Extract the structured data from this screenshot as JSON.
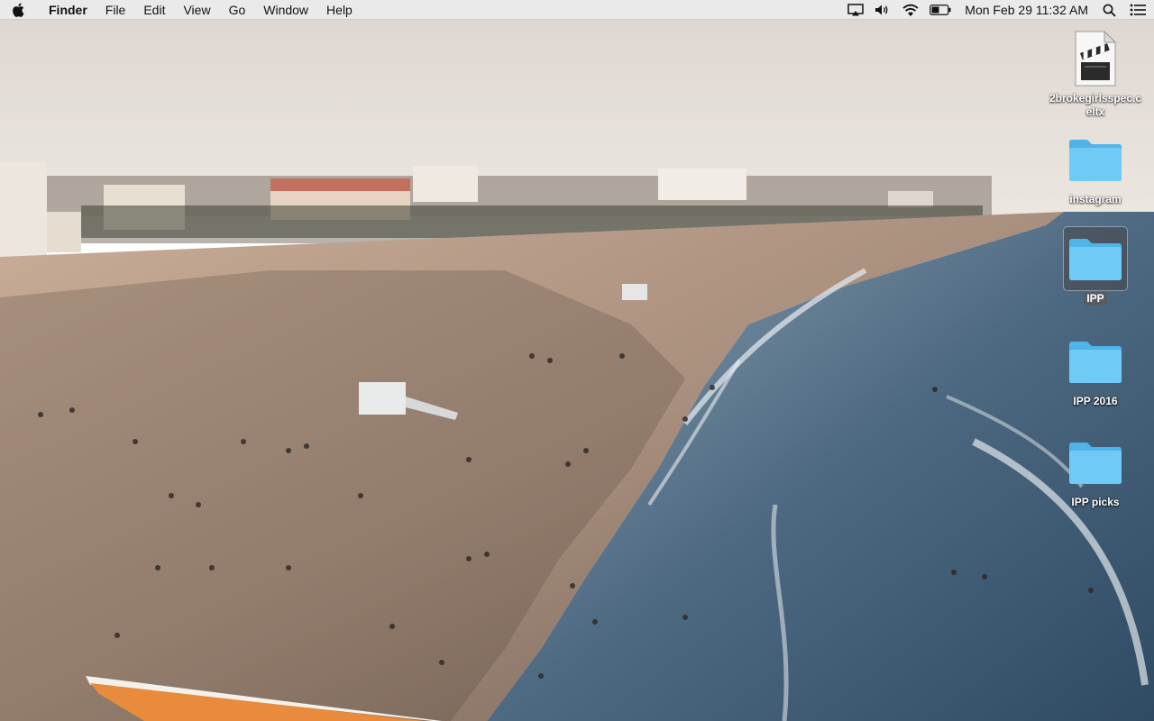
{
  "menubar": {
    "app_name": "Finder",
    "menus": [
      "File",
      "Edit",
      "View",
      "Go",
      "Window",
      "Help"
    ],
    "status_icons": [
      "airplay-icon",
      "volume-icon",
      "wifi-icon",
      "battery-icon"
    ],
    "clock": "Mon Feb 29  11:32 AM",
    "extra_icons": [
      "spotlight-search-icon",
      "notification-center-icon"
    ]
  },
  "desktop": {
    "wallpaper": "beach-aerial-photo",
    "icons": [
      {
        "label": "2brokegirlsspec.celtx",
        "type": "document",
        "selected": false
      },
      {
        "label": "instagram",
        "type": "folder",
        "selected": false
      },
      {
        "label": "IPP",
        "type": "folder",
        "selected": true
      },
      {
        "label": "IPP 2016",
        "type": "folder",
        "selected": false
      },
      {
        "label": "IPP picks",
        "type": "folder",
        "selected": false
      }
    ]
  },
  "colors": {
    "folder_blue": "#5ec2f2",
    "menubar_bg": "#ececec"
  }
}
